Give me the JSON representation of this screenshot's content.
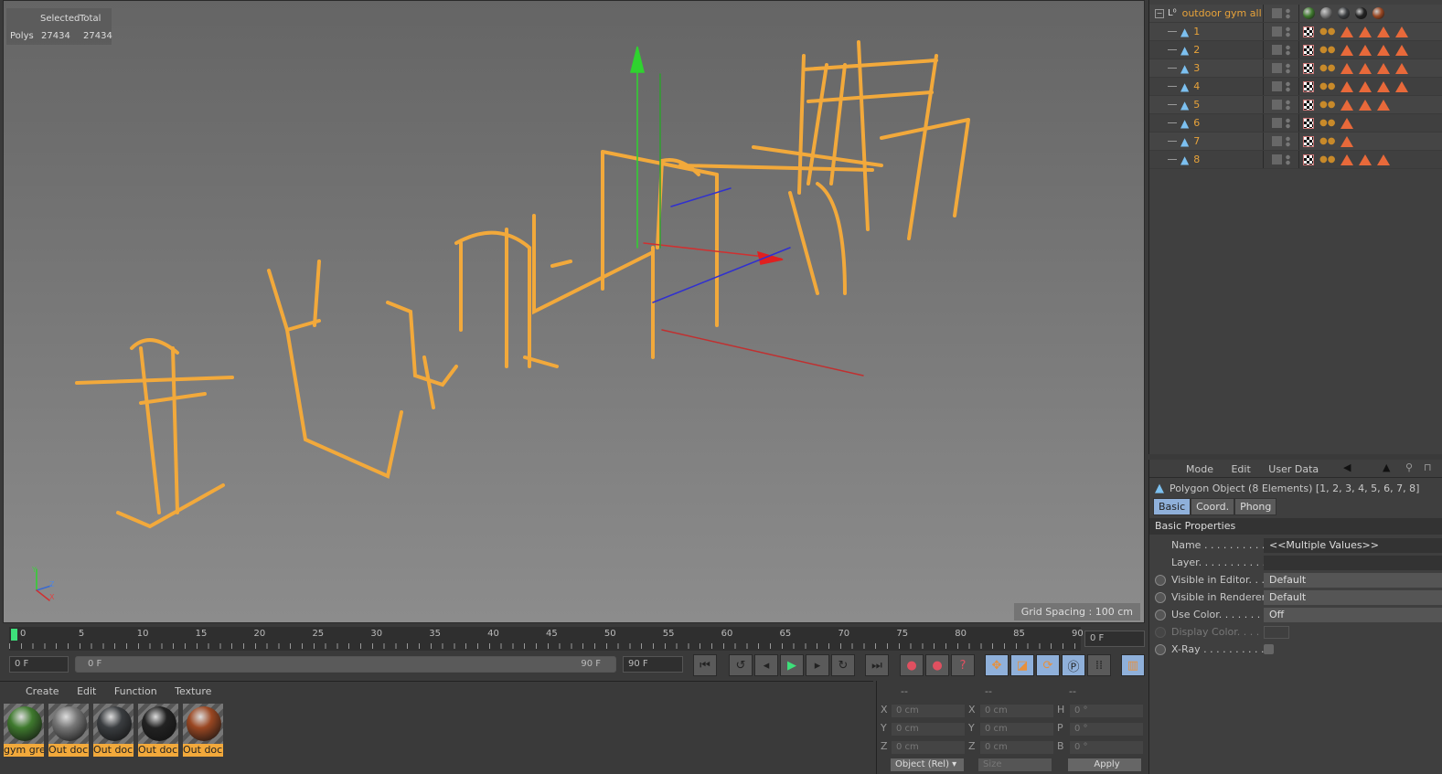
{
  "viewport": {
    "stats": {
      "header_selected": "Selected",
      "header_total": "Total",
      "row_label": "Polys",
      "selected": "27434",
      "total": "27434"
    },
    "grid_spacing": "Grid Spacing : 100 cm",
    "axis_labels": {
      "y": "Y",
      "z": "Z",
      "x": "X"
    },
    "wire_color": "#f2a93b"
  },
  "object_manager": {
    "root": {
      "name": "outdoor gym all",
      "materials": [
        "#3f7a2e",
        "#777777",
        "#3a3d40",
        "#222222",
        "#9a4722"
      ]
    },
    "objects": [
      {
        "name": "1",
        "tag_count": 4
      },
      {
        "name": "2",
        "tag_count": 4
      },
      {
        "name": "3",
        "tag_count": 4
      },
      {
        "name": "4",
        "tag_count": 4
      },
      {
        "name": "5",
        "tag_count": 3
      },
      {
        "name": "6",
        "tag_count": 1
      },
      {
        "name": "7",
        "tag_count": 1
      },
      {
        "name": "8",
        "tag_count": 3
      }
    ]
  },
  "attributes": {
    "menu": [
      "Mode",
      "Edit",
      "User Data"
    ],
    "title": "Polygon Object (8 Elements) [1, 2, 3, 4, 5, 6, 7, 8]",
    "tabs": [
      "Basic",
      "Coord.",
      "Phong"
    ],
    "section": "Basic Properties",
    "props": [
      {
        "label": "Name . . . . . . . . . . . .",
        "value": "<<Multiple Values>>"
      },
      {
        "label": "Layer. . . . . . . . . . . .",
        "value": ""
      },
      {
        "label": "Visible in Editor. . .",
        "value": "Default"
      },
      {
        "label": "Visible in Renderer",
        "value": "Default"
      },
      {
        "label": "Use Color. . . . . . . .",
        "value": "Off"
      },
      {
        "label": "Display Color. . . .",
        "value": ""
      },
      {
        "label": "X-Ray . . . . . . . . . . .",
        "value": ""
      }
    ]
  },
  "timeline": {
    "ticks": [
      "0",
      "5",
      "10",
      "15",
      "20",
      "25",
      "30",
      "35",
      "40",
      "45",
      "50",
      "55",
      "60",
      "65",
      "70",
      "75",
      "80",
      "85",
      "90"
    ],
    "current_frame": "0 F",
    "start": "0 F",
    "range_start": "0 F",
    "range_end": "90 F",
    "end": "90 F"
  },
  "materials": {
    "menu": [
      "Create",
      "Edit",
      "Function",
      "Texture"
    ],
    "items": [
      {
        "name": "gym gre",
        "color": "#3f7a2e"
      },
      {
        "name": "Out doc",
        "color": "#777777"
      },
      {
        "name": "Out doc",
        "color": "#3a3d40"
      },
      {
        "name": "Out doc",
        "color": "#222222"
      },
      {
        "name": "Out doc",
        "color": "#9a4722"
      }
    ]
  },
  "coordinates": {
    "headers": [
      "--",
      "--",
      "--"
    ],
    "rows": [
      {
        "l1": "X",
        "v1": "0 cm",
        "l2": "X",
        "v2": "0 cm",
        "l3": "H",
        "v3": "0 °"
      },
      {
        "l1": "Y",
        "v1": "0 cm",
        "l2": "Y",
        "v2": "0 cm",
        "l3": "P",
        "v3": "0 °"
      },
      {
        "l1": "Z",
        "v1": "0 cm",
        "l2": "Z",
        "v2": "0 cm",
        "l3": "B",
        "v3": "0 °"
      }
    ],
    "mode": "Object (Rel) ▾",
    "size": "Size",
    "apply": "Apply"
  }
}
